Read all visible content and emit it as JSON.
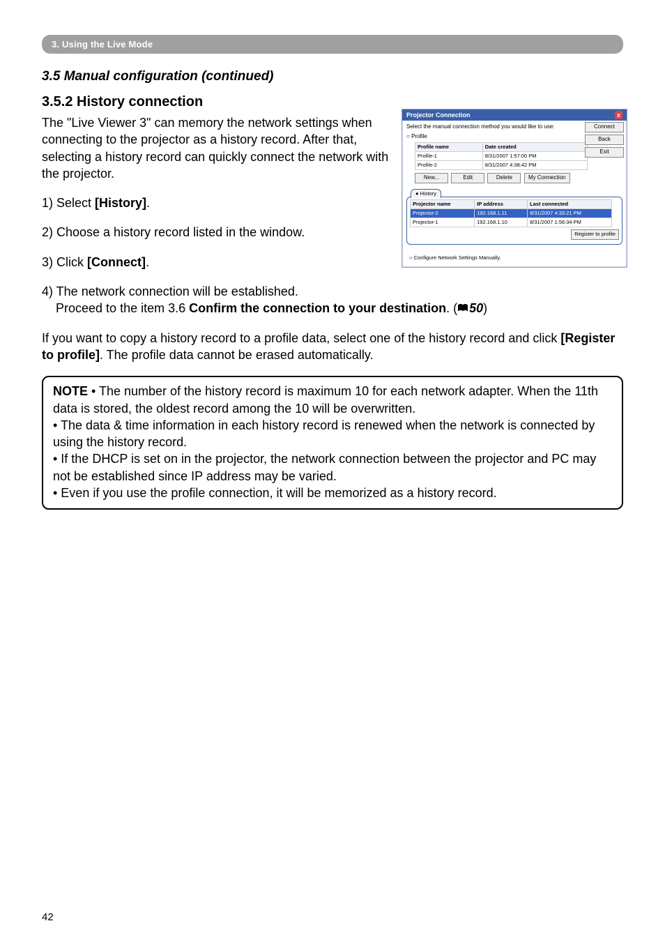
{
  "crumb": "3. Using the Live Mode",
  "heading": "3.5 Manual configuration (continued)",
  "subheading": "3.5.2 History connection",
  "intro": "The \"Live Viewer 3\" can memory the network settings when connecting to the projector as a history record. After that, selecting a history record can quickly connect the network with the projector.",
  "step1_pre": "1) Select ",
  "step1_bold": "[History]",
  "step1_post": ".",
  "step2": "2) Choose a history record listed in the window.",
  "step3_pre": "3) Click ",
  "step3_bold": "[Connect]",
  "step3_post": ".",
  "step4_line1": "4) The network connection will be established.",
  "step4_line2_pre": "Proceed to the item 3.6 ",
  "step4_line2_bold": "Confirm the connection to your destination",
  "step4_line2_post": ". (",
  "step4_ref": "50",
  "step4_close": ")",
  "para2_pre": "If you want to copy a history record to a profile data, select one of the history record and click ",
  "para2_bold": "[Register to profile]",
  "para2_post": ". The profile data cannot be erased automatically.",
  "note_label": "NOTE",
  "note_b1": " • The number of the history record is maximum 10 for each network adapter. When the 11th data is stored, the oldest record among the 10 will be overwritten.",
  "note_b2": "• The data & time information in each history record is renewed when the network is connected by using the history record.",
  "note_b3": "• If the DHCP is set on in the projector, the network connection between the projector and PC may not be established since IP address may be varied.",
  "note_b4": "• Even if you use the profile connection, it will be memorized as a history record.",
  "page_number": "42",
  "dialog": {
    "title": "Projector Connection",
    "instr": "Select the manual connection method you would like to use:",
    "radio_profile": "Profile",
    "btn_connect": "Connect",
    "btn_back": "Back",
    "btn_exit": "Exit",
    "profile_cols": {
      "c1": "Profile name",
      "c2": "Date created"
    },
    "profile_rows": [
      {
        "c1": "Profile-1",
        "c2": "8/31/2007 1:57:00 PM"
      },
      {
        "c1": "Profile-2",
        "c2": "8/31/2007 4:38:42 PM"
      }
    ],
    "btn_new": "New...",
    "btn_edit": "Edit",
    "btn_delete": "Delete",
    "btn_myconn": "My Connection",
    "radio_history": "History",
    "hist_cols": {
      "c1": "Projector name",
      "c2": "IP address",
      "c3": "Last connected"
    },
    "hist_rows": [
      {
        "c1": "Projector-2",
        "c2": "192.168.1.11",
        "c3": "8/31/2007 4:33:21 PM",
        "sel": true
      },
      {
        "c1": "Projector-1",
        "c2": "192.168.1.10",
        "c3": "8/31/2007 1:56:34 PM",
        "sel": false
      }
    ],
    "btn_register": "Register to profile",
    "cfg_manual": "Configure Network Settings Manually."
  }
}
